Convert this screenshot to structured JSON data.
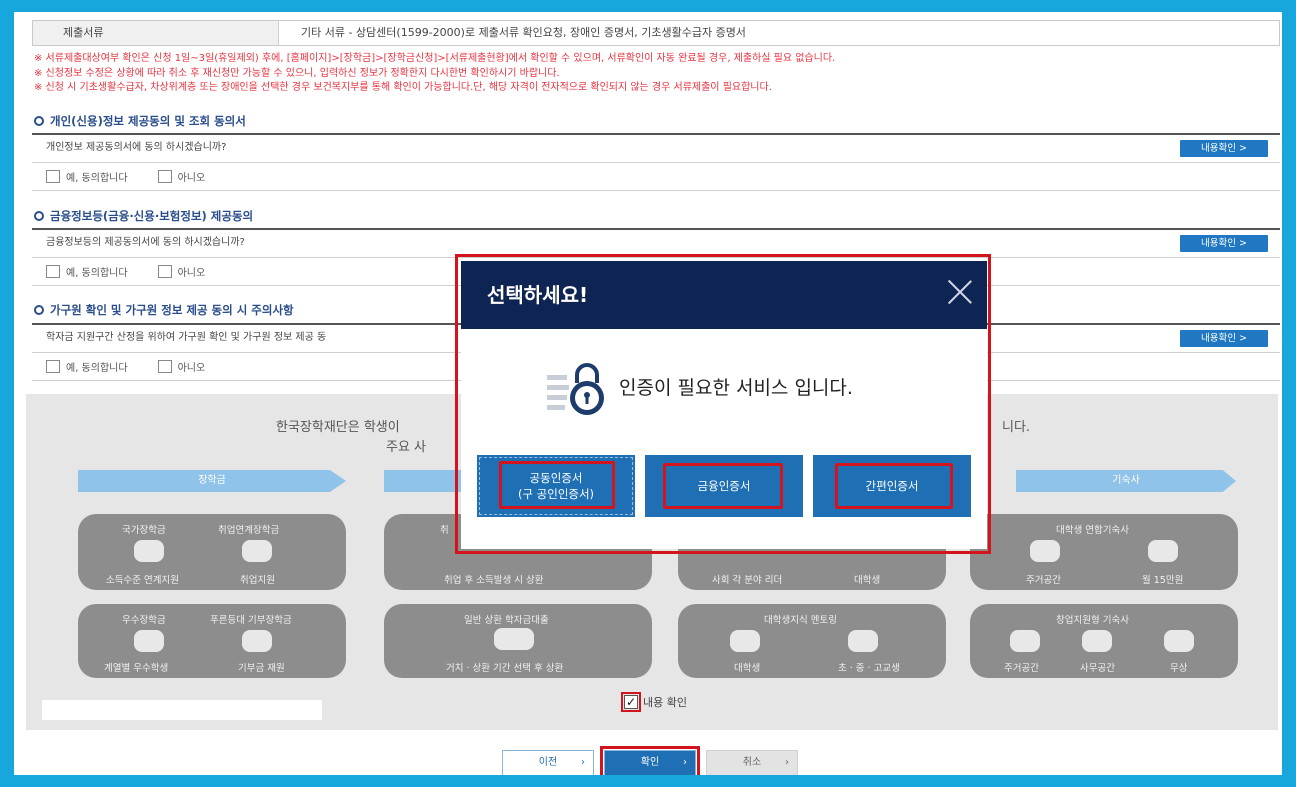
{
  "doc": {
    "label": "제출서류",
    "value": "기타 서류 - 상담센터(1599-2000)로 제출서류 확인요청, 장애인 증명서, 기초생활수급자 증명서"
  },
  "notices": [
    "※ 서류제출대상여부 확인은 신청 1일~3일(휴일제외) 후에, [홈페이지]>[장학금]>[장학금신청]>[서류제출현황]에서 확인할 수 있으며, 서류확인이 자동 완료될 경우, 제출하실 필요 없습니다.",
    "※ 신청정보 수정은 상황에 따라 취소 후 재신청만 가능할 수 있으니, 입력하신 정보가 정확한지 다시한번 확인하시기 바랍니다.",
    "※ 신청 시 기초생활수급자, 차상위계층 또는 장애인을 선택한 경우 보건복지부를 통해 확인이 가능합니다.단, 해당 자격이 전자적으로 확인되지 않는 경우 서류제출이 필요합니다."
  ],
  "sections": [
    {
      "title": "개인(신용)정보 제공동의 및 조회 동의서",
      "question": "개인정보 제공동의서에 동의 하시겠습니까?",
      "yes": "예, 동의합니다",
      "no": "아니오",
      "detail": "내용확인 >"
    },
    {
      "title": "금융정보등(금융·신용·보험정보) 제공동의",
      "question": "금융정보등의 제공동의서에 동의 하시겠습니까?",
      "yes": "예, 동의합니다",
      "no": "아니오",
      "detail": "내용확인 >"
    },
    {
      "title": "가구원 확인 및 가구원 정보 제공 동의 시 주의사항",
      "question": "학자금 지원구간 산정을 위하여 가구원 확인 및 가구원 정보 제공 동",
      "yes": "예, 동의합니다",
      "no": "아니오",
      "detail": "내용확인 >"
    }
  ],
  "panel": {
    "text_left": "한국장학재단은 학생이",
    "text_left2": "주요 사",
    "text_right": "니다.",
    "band_left": "장학금",
    "band_right": "기숙사",
    "cards": [
      {
        "a": "국가장학금",
        "b": "취업연계장학금",
        "c": "소득수준 연계지원",
        "d": "취업지원"
      },
      {
        "a": "우수장학금",
        "b": "푸른등대 기부장학금",
        "c": "계열별 우수학생",
        "d": "기부금 재원"
      },
      {
        "a": "취",
        "c": "취업 후 소득발생 시 상환"
      },
      {
        "a": "일반 상환 학자금대출",
        "c": "거치 · 상환 기간 선택 후 상환"
      },
      {
        "c": "사회 각 분야 리더",
        "d": "대학생"
      },
      {
        "a": "대학생지식 멘토링",
        "c": "대학생",
        "d": "초 · 중 · 고교생"
      },
      {
        "a": "대학생 연합기숙사",
        "c": "주거공간",
        "d": "월 15만원"
      },
      {
        "a": "창업지원형 기숙사",
        "c": "주거공간",
        "d": "사무공간",
        "e": "무상"
      }
    ],
    "confirm_label": "내용 확인"
  },
  "bottom": {
    "prev": "이전",
    "ok": "확인",
    "cancel": "취소"
  },
  "modal": {
    "title": "선택하세요!",
    "message": "인증이 필요한 서비스 입니다.",
    "btn1_line1": "공동인증서",
    "btn1_line2": "(구 공인인증서)",
    "btn2": "금융인증서",
    "btn3": "간편인증서"
  },
  "colors": {
    "accent": "#1f6fb4",
    "modal_header": "#0e2554",
    "highlight": "#d4141c",
    "notice": "#e8333f"
  }
}
